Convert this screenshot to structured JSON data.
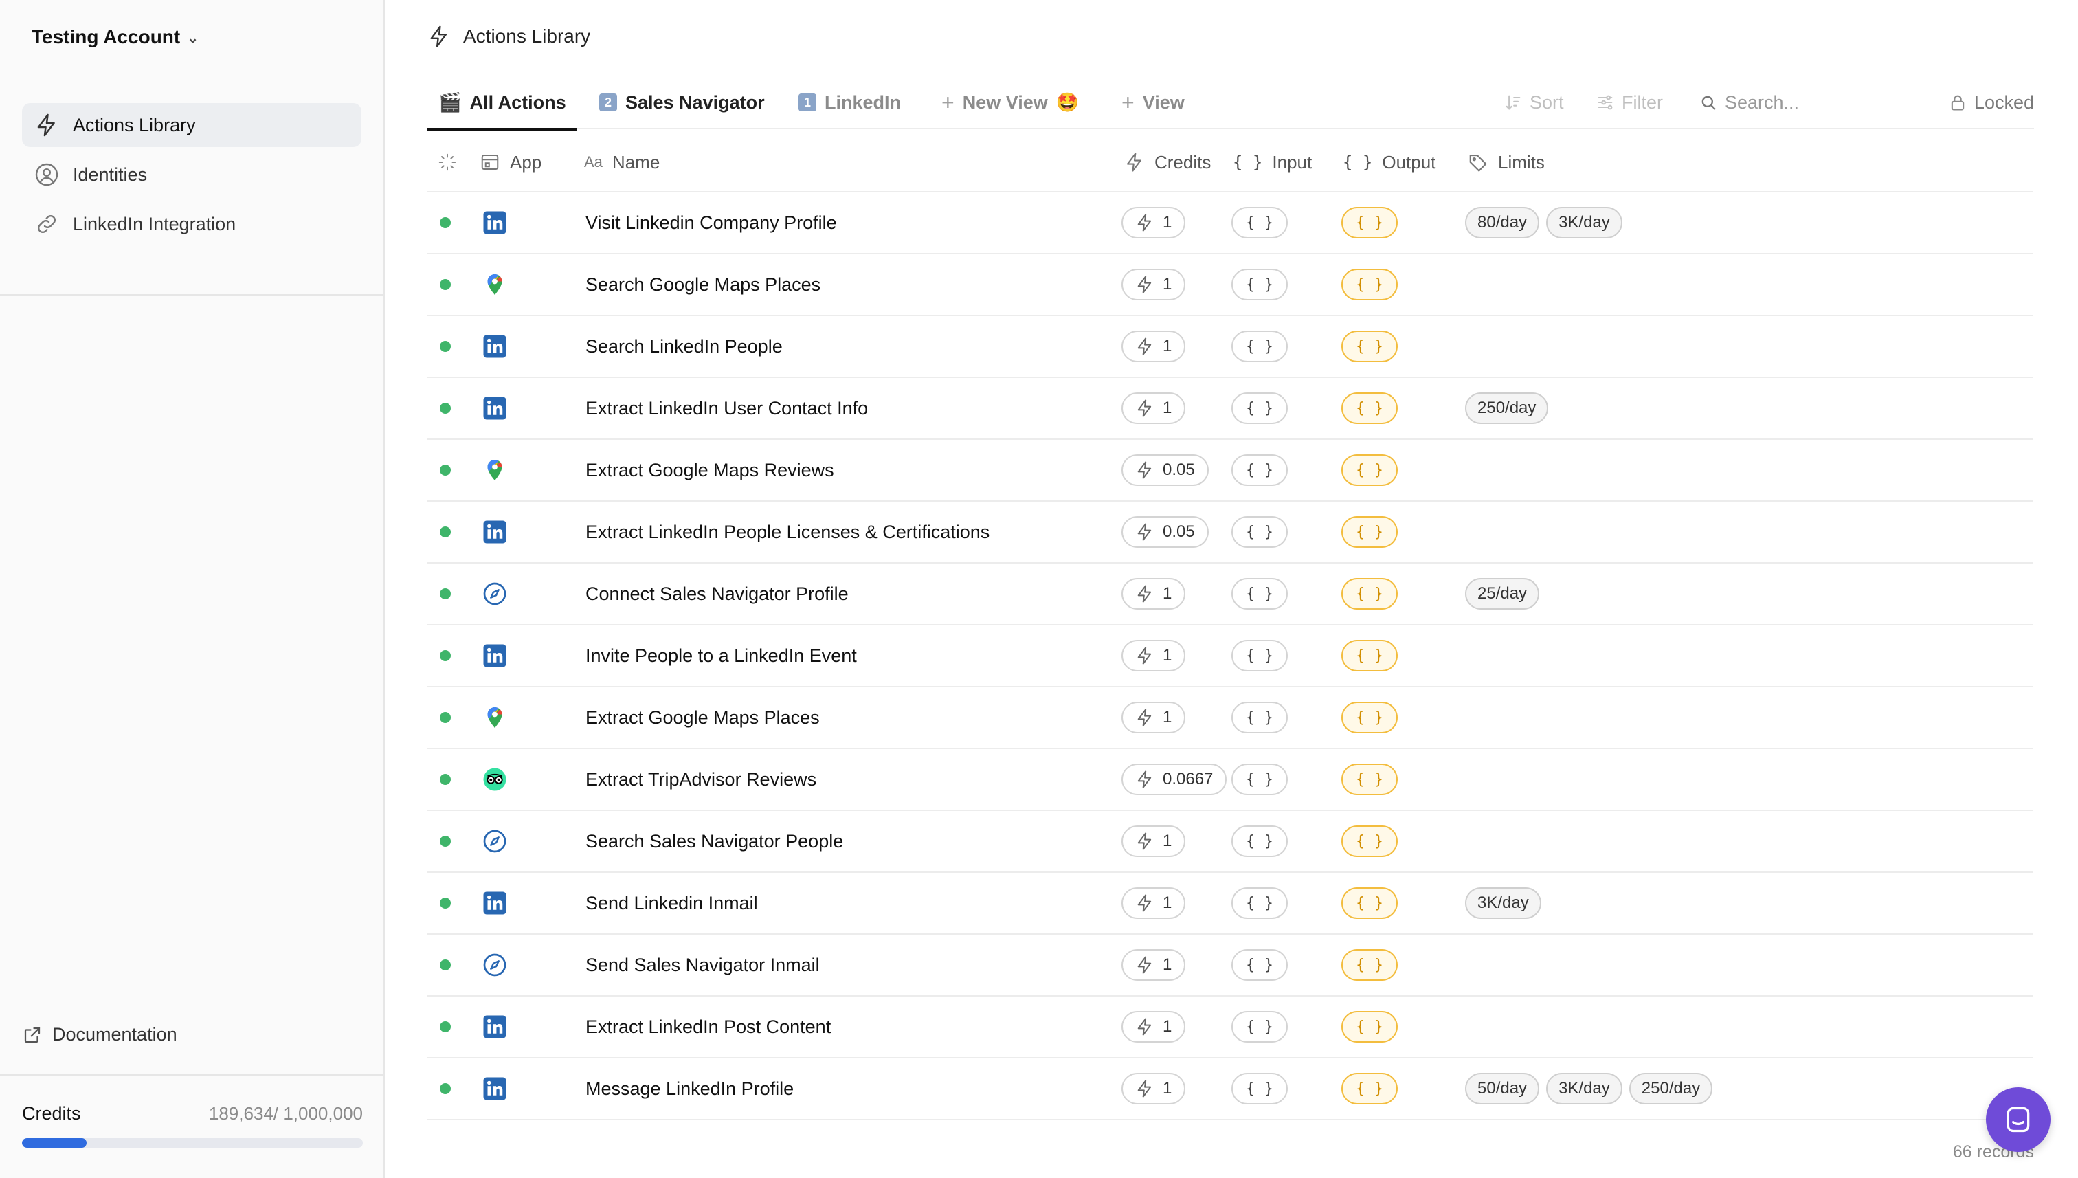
{
  "account": {
    "name": "Testing Account"
  },
  "sidebar": {
    "items": [
      {
        "label": "Actions Library",
        "icon": "lightning-icon"
      },
      {
        "label": "Identities",
        "icon": "user-circle-icon"
      },
      {
        "label": "LinkedIn Integration",
        "icon": "link-icon"
      }
    ],
    "documentation": "Documentation",
    "credits": {
      "label": "Credits",
      "value": "189,634/ 1,000,000",
      "used_fraction": 0.1896
    }
  },
  "header": {
    "title": "Actions Library"
  },
  "tabs": [
    {
      "label": "All Actions",
      "emoji": "🎬"
    },
    {
      "label": "Sales Navigator",
      "badge": "2"
    },
    {
      "label": "LinkedIn",
      "badge": "1"
    },
    {
      "label": "New View",
      "emoji": "🤩"
    },
    {
      "label": "View"
    }
  ],
  "toolbar": {
    "sort": "Sort",
    "filter": "Filter",
    "search_placeholder": "Search...",
    "locked": "Locked"
  },
  "columns": {
    "app": "App",
    "name": "Name",
    "name_prefix": "Aa",
    "credits": "Credits",
    "input": "Input",
    "output": "Output",
    "limits": "Limits"
  },
  "rows": [
    {
      "app": "linkedin",
      "name": "Visit Linkedin Company Profile",
      "credits": "1",
      "limits": [
        "80/day",
        "3K/day"
      ]
    },
    {
      "app": "google-maps",
      "name": "Search Google Maps Places",
      "credits": "1",
      "limits": []
    },
    {
      "app": "linkedin",
      "name": "Search LinkedIn People",
      "credits": "1",
      "limits": []
    },
    {
      "app": "linkedin",
      "name": "Extract LinkedIn User Contact Info",
      "credits": "1",
      "limits": [
        "250/day"
      ]
    },
    {
      "app": "google-maps",
      "name": "Extract Google Maps Reviews",
      "credits": "0.05",
      "limits": []
    },
    {
      "app": "linkedin",
      "name": "Extract LinkedIn People Licenses & Certifications",
      "credits": "0.05",
      "limits": []
    },
    {
      "app": "sales-navigator",
      "name": "Connect Sales Navigator Profile",
      "credits": "1",
      "limits": [
        "25/day"
      ]
    },
    {
      "app": "linkedin",
      "name": "Invite People to a LinkedIn Event",
      "credits": "1",
      "limits": []
    },
    {
      "app": "google-maps",
      "name": "Extract Google Maps Places",
      "credits": "1",
      "limits": []
    },
    {
      "app": "tripadvisor",
      "name": "Extract TripAdvisor Reviews",
      "credits": "0.0667",
      "limits": []
    },
    {
      "app": "sales-navigator",
      "name": "Search Sales Navigator People",
      "credits": "1",
      "limits": []
    },
    {
      "app": "linkedin",
      "name": "Send Linkedin Inmail",
      "credits": "1",
      "limits": [
        "3K/day"
      ]
    },
    {
      "app": "sales-navigator",
      "name": "Send Sales Navigator Inmail",
      "credits": "1",
      "limits": []
    },
    {
      "app": "linkedin",
      "name": "Extract LinkedIn Post Content",
      "credits": "1",
      "limits": []
    },
    {
      "app": "linkedin",
      "name": "Message LinkedIn Profile",
      "credits": "1",
      "limits": [
        "50/day",
        "3K/day",
        "250/day"
      ]
    }
  ],
  "braces": "{ }",
  "footer": {
    "records": "66 records"
  },
  "colors": {
    "accent": "#2f6bdf",
    "status_active": "#3fb56a",
    "output": "#f3bd3e",
    "chat": "#6f4bd8"
  }
}
